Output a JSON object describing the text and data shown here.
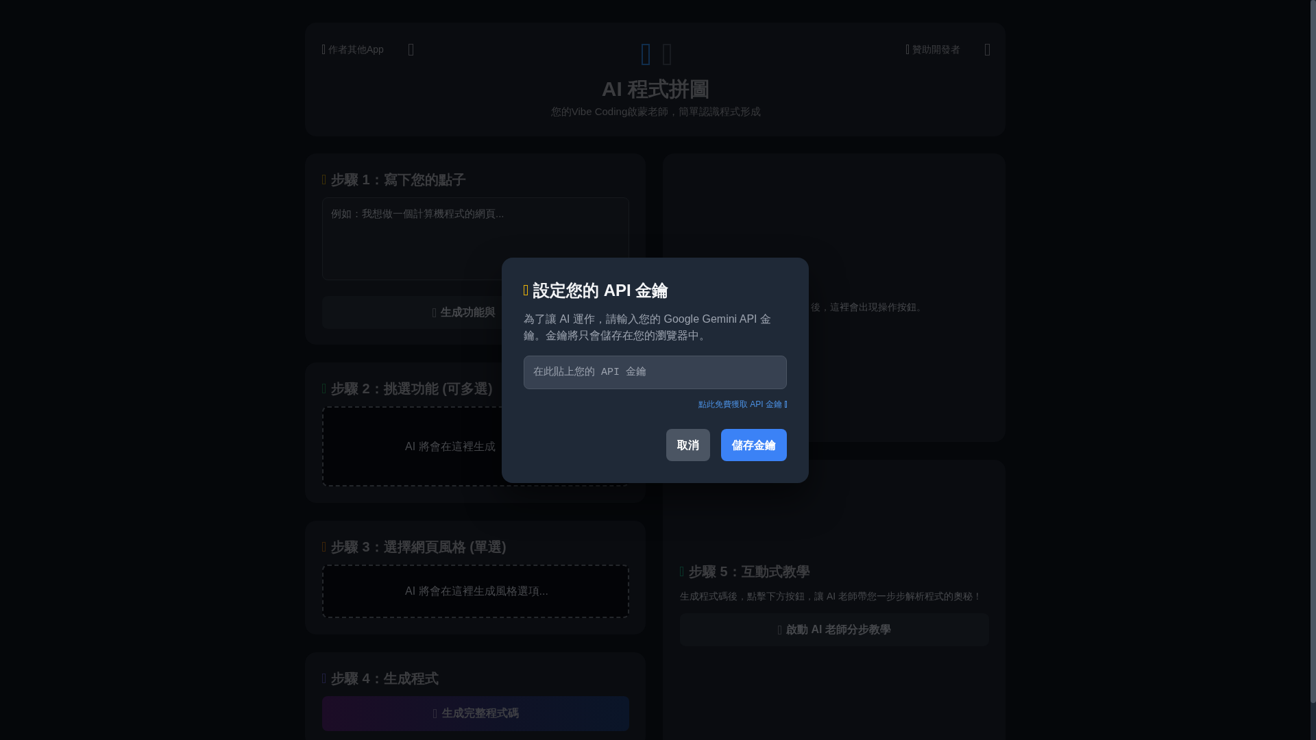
{
  "header": {
    "left_link": {
      "label": "作者其他App"
    },
    "right_link": {
      "label": "贊助開發者"
    },
    "title": "AI 程式拼圖",
    "subtitle": "您的Vibe Coding啟蒙老師，簡單認識程式形成"
  },
  "left_steps": [
    {
      "kind": "idea",
      "color": "#3a2e06",
      "title": "步驟 1：寫下您的點子",
      "placeholder": "例如：我想做一個計算機程式的網頁...",
      "button": "生成功能與"
    },
    {
      "kind": "choices",
      "color": "#0b2e1c",
      "title": "步驟 2：挑選功能 (可多選)",
      "empty_text": "AI 將會在這裡生成"
    },
    {
      "kind": "choices",
      "color": "#3a2308",
      "title": "步驟 3：選擇網頁風格 (單選)",
      "empty_text": "AI 將會在這裡生成風格選項..."
    },
    {
      "kind": "generate",
      "color": "#1e1d3d",
      "title": "步驟 4：生成程式",
      "button": "生成完整程式碼"
    }
  ],
  "output_panel": {
    "message": "後，這裡會出現操作按鈕。"
  },
  "tutorial": {
    "title": "步驟 5：互動式教學",
    "description": "生成程式碼後，點擊下方按鈕，讓 AI 老師帶您一步步解析程式的奧秘！",
    "button": "啟動 AI 老師分步教學"
  },
  "modal": {
    "title": "設定您的 API 金鑰",
    "description": "為了讓 AI 運作，請輸入您的 Google Gemini API 金鑰。金鑰將只會儲存在您的瀏覽器中。",
    "input": {
      "placeholder": "在此貼上您的 API 金鑰"
    },
    "link": "點此免費獲取 API 金鑰",
    "buttons": [
      {
        "kind": "secondary",
        "label": "取消"
      },
      {
        "kind": "primary",
        "label": "儲存金鑰"
      }
    ]
  }
}
